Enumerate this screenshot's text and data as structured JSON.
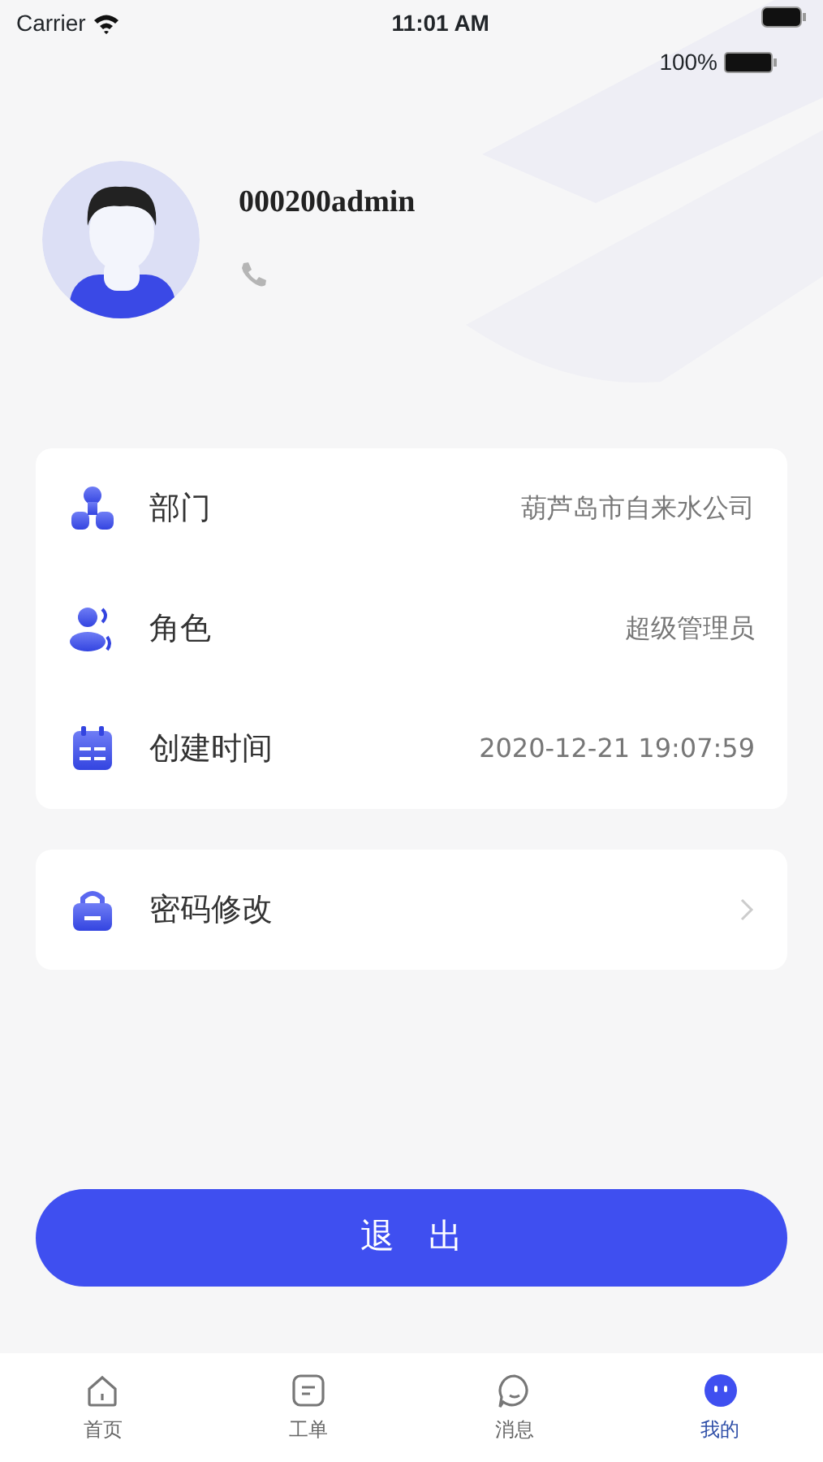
{
  "status_bar": {
    "carrier": "Carrier",
    "time": "11:01 AM",
    "battery": "100%"
  },
  "profile": {
    "username": "000200admin"
  },
  "info": [
    {
      "label": "部门",
      "value": "葫芦岛市自来水公司"
    },
    {
      "label": "角色",
      "value": "超级管理员"
    },
    {
      "label": "创建时间",
      "value": "2020-12-21 19:07:59"
    }
  ],
  "actions": [
    {
      "label": "密码修改"
    }
  ],
  "logout_button": "退　出",
  "tab_bar": [
    {
      "label": "首页",
      "selected": false
    },
    {
      "label": "工单",
      "selected": false
    },
    {
      "label": "消息",
      "selected": false
    },
    {
      "label": "我的",
      "selected": true
    }
  ]
}
